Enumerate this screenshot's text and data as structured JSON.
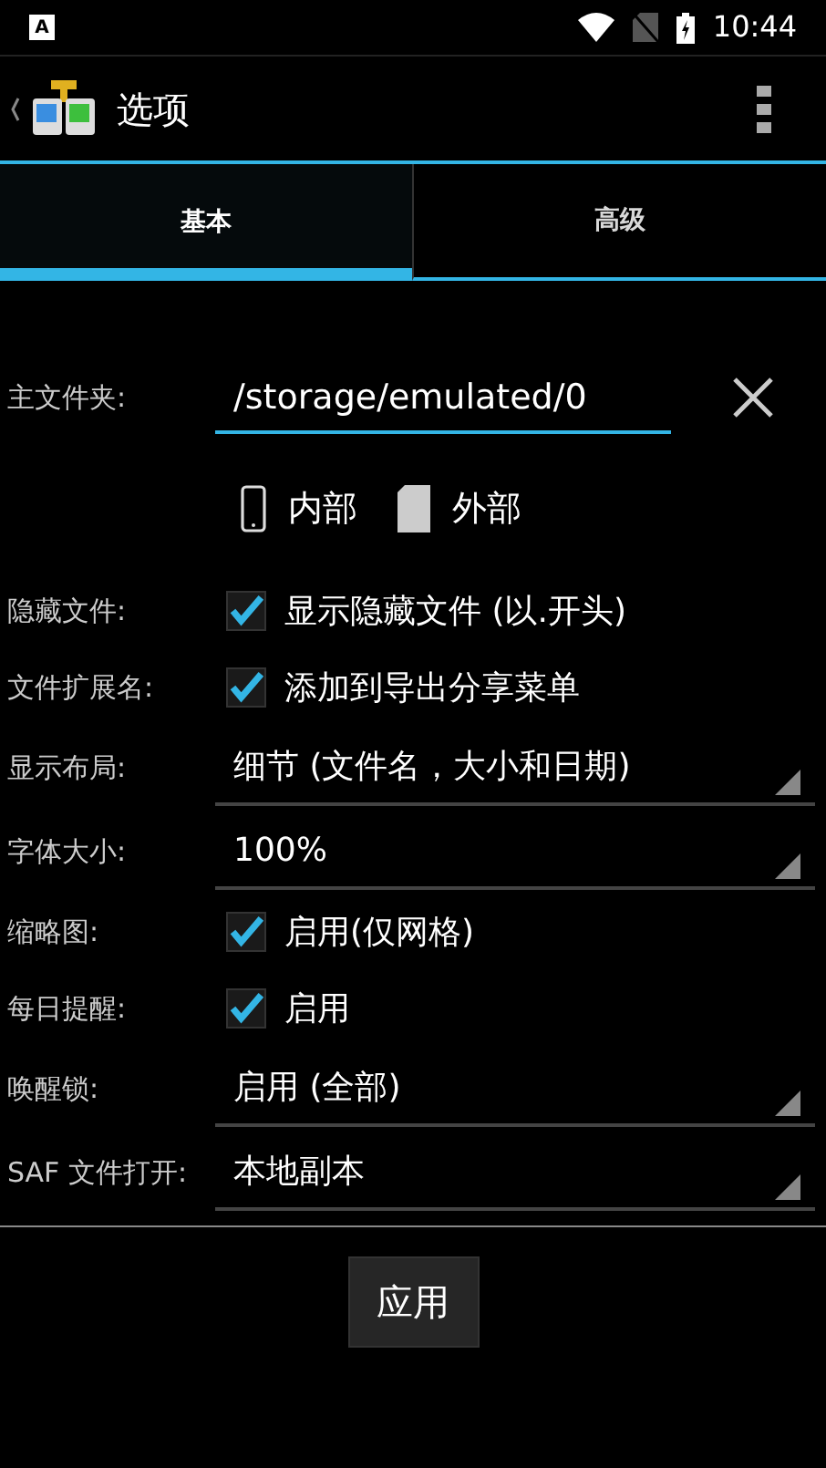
{
  "status_bar": {
    "time": "10:44",
    "notification": "A"
  },
  "action_bar": {
    "title": "选项"
  },
  "tabs": [
    {
      "label": "基本",
      "selected": true
    },
    {
      "label": "高级",
      "selected": false
    }
  ],
  "home_folder": {
    "label": "主文件夹:",
    "value": "/storage/emulated/0"
  },
  "storage": [
    {
      "kind": "phone",
      "label": "内部"
    },
    {
      "kind": "sdcard",
      "label": "外部"
    }
  ],
  "settings": [
    {
      "kind": "checkbox",
      "label": "隐藏文件:",
      "text": "显示隐藏文件 (以.开头)",
      "checked": true
    },
    {
      "kind": "checkbox",
      "label": "文件扩展名:",
      "text": "添加到导出分享菜单",
      "checked": true
    },
    {
      "kind": "dropdown",
      "label": "显示布局:",
      "value": "细节 (文件名，大小和日期)"
    },
    {
      "kind": "dropdown",
      "label": "字体大小:",
      "value": "100%"
    },
    {
      "kind": "checkbox",
      "label": "缩略图:",
      "text": "启用(仅网格)",
      "checked": true
    },
    {
      "kind": "checkbox",
      "label": "每日提醒:",
      "text": "启用",
      "checked": true
    },
    {
      "kind": "dropdown",
      "label": "唤醒锁:",
      "value": "启用 (全部)"
    },
    {
      "kind": "dropdown",
      "label": "SAF 文件打开:",
      "value": "本地副本"
    }
  ],
  "apply_button": "应用"
}
